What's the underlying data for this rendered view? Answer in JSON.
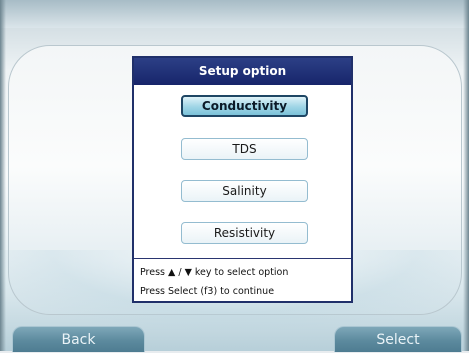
{
  "dialog": {
    "title": "Setup option",
    "options": [
      {
        "label": "Conductivity",
        "selected": true
      },
      {
        "label": "TDS",
        "selected": false
      },
      {
        "label": "Salinity",
        "selected": false
      },
      {
        "label": "Resistivity",
        "selected": false
      }
    ],
    "help_line_1": "Press ▲ / ▼ key to select option",
    "help_line_2": "Press Select (f3) to continue"
  },
  "softkeys": {
    "left_label": "Back",
    "right_label": "Select"
  },
  "colors": {
    "title_bar": "#1f2f78",
    "selected_option": "#8fcde0",
    "softkey": "#5c8a9e"
  }
}
